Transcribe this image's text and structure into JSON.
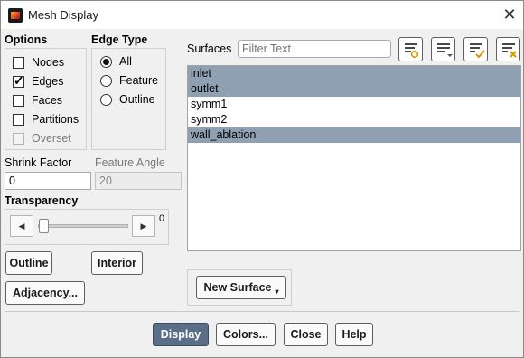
{
  "window": {
    "title": "Mesh Display",
    "close_glyph": "✕",
    "app_icon": "fluent-app-icon"
  },
  "options": {
    "header": "Options",
    "items": [
      {
        "label": "Nodes",
        "checked": false,
        "enabled": true
      },
      {
        "label": "Edges",
        "checked": true,
        "enabled": true
      },
      {
        "label": "Faces",
        "checked": false,
        "enabled": true
      },
      {
        "label": "Partitions",
        "checked": false,
        "enabled": true
      },
      {
        "label": "Overset",
        "checked": false,
        "enabled": false
      }
    ]
  },
  "edge_type": {
    "header": "Edge Type",
    "items": [
      {
        "label": "All",
        "selected": true
      },
      {
        "label": "Feature",
        "selected": false
      },
      {
        "label": "Outline",
        "selected": false
      }
    ]
  },
  "shrink": {
    "label": "Shrink Factor",
    "value": "0"
  },
  "feature_angle": {
    "label": "Feature Angle",
    "value": "20"
  },
  "transparency": {
    "label": "Transparency",
    "value": "0",
    "left_glyph": "◀",
    "right_glyph": "▶",
    "level": 0
  },
  "buttons": {
    "outline": "Outline",
    "interior": "Interior",
    "adjacency": "Adjacency..."
  },
  "surfaces": {
    "label": "Surfaces",
    "filter_placeholder": "Filter Text",
    "items": [
      {
        "name": "inlet",
        "selected": true
      },
      {
        "name": "outlet",
        "selected": true
      },
      {
        "name": "symm1",
        "selected": false
      },
      {
        "name": "symm2",
        "selected": false
      },
      {
        "name": "wall_ablation",
        "selected": true
      }
    ],
    "toolbar_icons": [
      "filter-text-icon",
      "list-options-icon",
      "select-all-icon",
      "deselect-all-icon"
    ]
  },
  "new_surface": {
    "label": "New Surface",
    "caret": "▾"
  },
  "footer": {
    "display": "Display",
    "colors": "Colors...",
    "close": "Close",
    "help": "Help"
  },
  "colors": {
    "selection": "#8fa0b3",
    "primary_button": "#5a6f87"
  }
}
